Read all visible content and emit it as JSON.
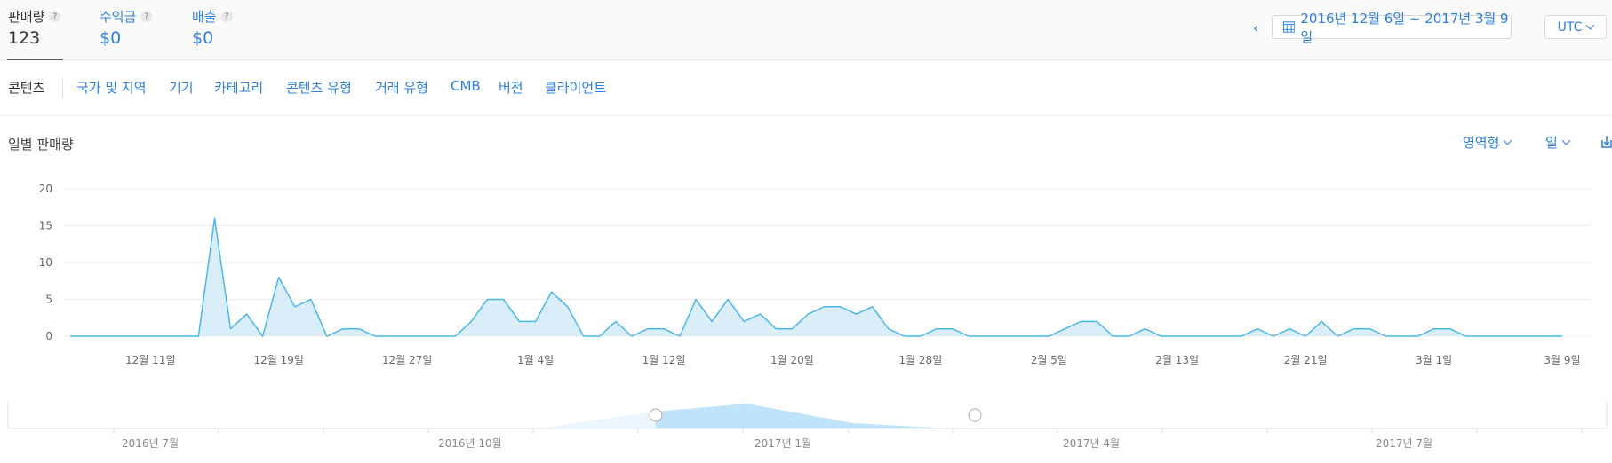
{
  "metrics": [
    {
      "label": "판매량",
      "value": "123",
      "help": "?"
    },
    {
      "label": "수익금",
      "value": "$0",
      "help": "?"
    },
    {
      "label": "매출",
      "value": "$0",
      "help": "?"
    }
  ],
  "date_nav": {
    "prev_icon": "chevron-left-icon",
    "prev_glyph": "‹",
    "calendar_icon": "calendar-icon",
    "range_label": "2016년 12월 6일 ~ 2017년 3월 9일"
  },
  "timezone": {
    "label": "UTC"
  },
  "tabs": [
    "콘텐츠",
    "국가 및 지역",
    "기기",
    "카테고리",
    "콘텐츠 유형",
    "거래 유형",
    "CMB",
    "버전",
    "클라이언트"
  ],
  "chart_header": {
    "title": "일별 판매량",
    "chart_type_label": "영역형",
    "interval_label": "일",
    "export_icon": "download-icon"
  },
  "colors": {
    "accent": "#2f7fdc",
    "series_line": "#4ab6ea",
    "series_fill": "#d6ecf9",
    "grid": "#ececec"
  },
  "chart_data": {
    "type": "area",
    "title": "일별 판매량",
    "x_range": [
      "2016-12-06",
      "2017-03-09"
    ],
    "x_tick_labels": [
      "12월 11일",
      "12월 19일",
      "12월 27일",
      "1월 4일",
      "1월 12일",
      "1월 20일",
      "1월 28일",
      "2월 5일",
      "2월 13일",
      "2월 21일",
      "3월 1일",
      "3월 9일"
    ],
    "y_ticks": [
      0,
      5,
      10,
      15,
      20
    ],
    "ylim": [
      0,
      20
    ],
    "grid": true,
    "series": [
      {
        "values": [
          0,
          0,
          0,
          0,
          0,
          0,
          0,
          0,
          0,
          16,
          1,
          3,
          0,
          8,
          4,
          5,
          0,
          1,
          1,
          0,
          0,
          0,
          0,
          0,
          0,
          2,
          5,
          5,
          2,
          2,
          6,
          4,
          0,
          0,
          2,
          0,
          1,
          1,
          0,
          5,
          2,
          5,
          2,
          3,
          1,
          1,
          3,
          4,
          4,
          3,
          4,
          1,
          0,
          0,
          1,
          1,
          0,
          0,
          0,
          0,
          0,
          0,
          1,
          2,
          2,
          0,
          0,
          1,
          0,
          0,
          0,
          0,
          0,
          0,
          1,
          0,
          1,
          0,
          2,
          0,
          1,
          1,
          0,
          0,
          0,
          1,
          1,
          0,
          0,
          0,
          0,
          0,
          0,
          0
        ]
      }
    ]
  },
  "overview": {
    "labels": [
      "2016년 7월",
      "2016년 10월",
      "2017년 1월",
      "2017년 4월",
      "2017년 7월"
    ]
  }
}
